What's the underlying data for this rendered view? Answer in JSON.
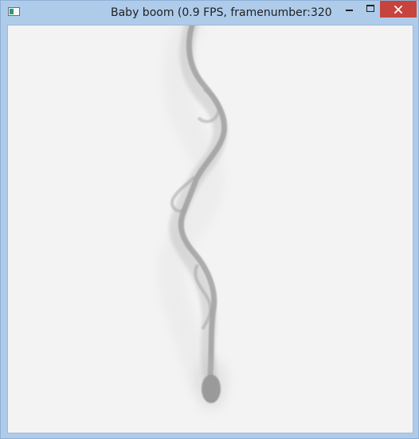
{
  "window": {
    "title": "Baby boom (0.9 FPS, framenumber:320",
    "icon": "app-window-icon",
    "controls": {
      "minimize": "minimize-icon",
      "maximize": "maximize-icon",
      "close": "close-icon"
    }
  },
  "colors": {
    "titlebar": "#aecbea",
    "client_background": "#f3f3f3",
    "close_button": "#c7433d",
    "smoke_dark": "#8f8f8f",
    "smoke_mid": "#b3b3b3",
    "smoke_light": "#dedede"
  }
}
